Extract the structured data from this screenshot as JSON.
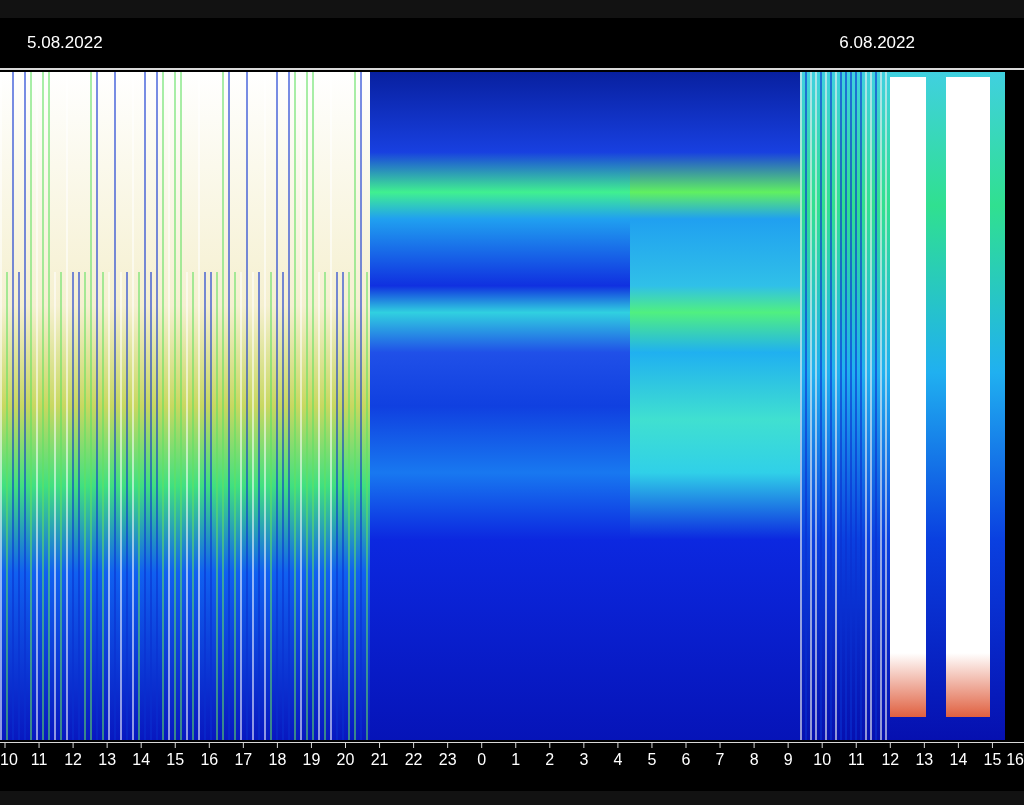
{
  "header": {
    "dates": [
      "5.08.2022",
      "6.08.2022"
    ]
  },
  "time_axis": {
    "labels": [
      "10",
      "11",
      "12",
      "13",
      "14",
      "15",
      "16",
      "17",
      "18",
      "19",
      "20",
      "21",
      "22",
      "23",
      "0",
      "1",
      "2",
      "3",
      "4",
      "5",
      "6",
      "7",
      "8",
      "9",
      "10",
      "11",
      "12",
      "13",
      "14",
      "15",
      "16"
    ]
  }
}
